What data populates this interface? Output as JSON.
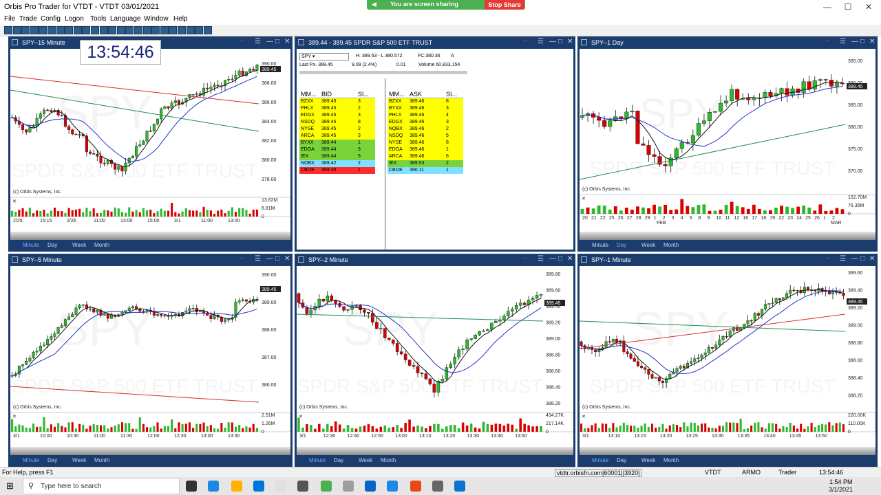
{
  "app": {
    "title": "Orbis Pro Trader for VTDT - VTDT 03/01/2021",
    "sharing_text": "You are screen sharing",
    "stop_share": "Stop Share",
    "clock": "13:54:46"
  },
  "menu": [
    "File",
    "Trade",
    "Config",
    "Logon",
    "Tools",
    "Language",
    "Window",
    "Help"
  ],
  "colors": {
    "panel": "#1b3d6e",
    "up": "#2eb82e",
    "down": "#d80000",
    "yellow": "#ffff00",
    "green": "#7ad33a",
    "cyan": "#7fe0ff",
    "red": "#ff2a2a"
  },
  "panels": {
    "p15": {
      "title": "SPY--15 Minute",
      "yaxis": [
        "390.00",
        "388.00",
        "386.00",
        "384.00",
        "382.00",
        "380.00",
        "378.00"
      ],
      "price": "389.45",
      "xaxis": [
        "2/25",
        "15:15",
        "2/26",
        "11:00",
        "13:00",
        "15:00",
        "3/1",
        "11:00",
        "13:00"
      ],
      "vol": [
        "13.62M",
        "6.81M",
        "0"
      ],
      "tabs": [
        "Minute",
        "Day",
        "Week",
        "Month"
      ]
    },
    "pday": {
      "title": "SPY--1 Day",
      "yaxis": [
        "395.00",
        "390.00",
        "385.00",
        "380.00",
        "375.00",
        "370.00"
      ],
      "price": "389.45",
      "xaxis": [
        "20",
        "21",
        "22",
        "25",
        "26",
        "27",
        "28",
        "29",
        "1",
        "2",
        "3",
        "4",
        "5",
        "8",
        "9",
        "10",
        "11",
        "12",
        "16",
        "17",
        "18",
        "19",
        "22",
        "23",
        "24",
        "25",
        "26",
        "1",
        "2"
      ],
      "month_labels": [
        "FEB",
        "MAR"
      ],
      "vol": [
        "152.70M",
        "76.35M",
        "0"
      ],
      "tabs": [
        "Minute",
        "Day",
        "Week",
        "Month"
      ]
    },
    "p5": {
      "title": "SPY--5 Minute",
      "yaxis": [
        "390.00",
        "389.00",
        "388.00",
        "387.00",
        "386.00"
      ],
      "price": "389.45",
      "xaxis": [
        "3/1",
        "10:00",
        "10:30",
        "11:00",
        "11:30",
        "12:00",
        "12:30",
        "13:00",
        "13:30"
      ],
      "vol": [
        "2.51M",
        "1.26M",
        "0"
      ],
      "tabs": [
        "Minute",
        "Day",
        "Week",
        "Month"
      ]
    },
    "p2": {
      "title": "SPY--2 Minute",
      "yaxis": [
        "389.80",
        "389.60",
        "389.40",
        "389.20",
        "389.00",
        "388.80",
        "388.60",
        "388.40",
        "388.20"
      ],
      "price": "389.45",
      "xaxis": [
        "3/1",
        "12:30",
        "12:40",
        "12:50",
        "13:00",
        "13:10",
        "13:20",
        "13:30",
        "13:40",
        "13:50"
      ],
      "vol": [
        "434.27K",
        "217.14K",
        "0"
      ],
      "tabs": [
        "Minute",
        "Day",
        "Week",
        "Month"
      ]
    },
    "p1": {
      "title": "SPY--1 Minute",
      "yaxis": [
        "389.60",
        "389.40",
        "389.20",
        "389.00",
        "388.80",
        "388.60",
        "388.40",
        "388.20"
      ],
      "price": "389.45",
      "xaxis": [
        "3/1",
        "13:10",
        "13:15",
        "13:20",
        "13:25",
        "13:30",
        "13:35",
        "13:40",
        "13:45",
        "13:50"
      ],
      "vol": [
        "220.00K",
        "110.00K",
        "0"
      ],
      "tabs": [
        "Minute",
        "Day",
        "Week",
        "Month"
      ]
    }
  },
  "copyright": "(c) Orbis Systems, Inc.",
  "watermark": {
    "symbol": "SPY",
    "name": "SPDR S&P 500 ETF TRUST"
  },
  "level2": {
    "title": "389.44 - 389.45   SPDR S&P 500 ETF TRUST",
    "symbol": "SPY",
    "high": "H: 389.63 - L 380.572",
    "fc": "FC:380.36",
    "a": "A",
    "last": "Last Px.  389.45",
    "change": "9.09  (2.4%)",
    "tick": "0.01",
    "volume": "Volume  60,833,154",
    "bid_headers": [
      "MM...",
      "BID",
      "SI..."
    ],
    "ask_headers": [
      "MM...",
      "ASK",
      "SI..."
    ],
    "bids": [
      [
        "BZXX",
        "389.45",
        "3",
        "yellow"
      ],
      [
        "PHLX",
        "389.45",
        "2",
        "yellow"
      ],
      [
        "EDGX",
        "389.45",
        "3",
        "yellow"
      ],
      [
        "NSDQ",
        "389.45",
        "8",
        "yellow"
      ],
      [
        "NYSE",
        "389.45",
        "2",
        "yellow"
      ],
      [
        "ARCA",
        "389.45",
        "3",
        "yellow"
      ],
      [
        "BYXX",
        "389.44",
        "1",
        "green"
      ],
      [
        "EDGA",
        "389.44",
        "3",
        "green"
      ],
      [
        "IEX",
        "389.44",
        "5",
        "green"
      ],
      [
        "NOBX",
        "389.42",
        "2",
        "cyan"
      ],
      [
        "CBOE",
        "389.39",
        "1",
        "red"
      ]
    ],
    "asks": [
      [
        "BZXX",
        "389.46",
        "8",
        "yellow"
      ],
      [
        "BYXX",
        "389.46",
        "3",
        "yellow"
      ],
      [
        "PHLX",
        "389.46",
        "4",
        "yellow"
      ],
      [
        "EDGX",
        "389.46",
        "3",
        "yellow"
      ],
      [
        "NQBX",
        "389.46",
        "2",
        "yellow"
      ],
      [
        "NSDQ",
        "389.46",
        "5",
        "yellow"
      ],
      [
        "NYSE",
        "389.46",
        "8",
        "yellow"
      ],
      [
        "EDGA",
        "389.46",
        "1",
        "yellow"
      ],
      [
        "ARCA",
        "389.46",
        "6",
        "yellow"
      ],
      [
        "IEX",
        "389.53",
        "2",
        "green"
      ],
      [
        "CBOE",
        "390.11",
        "1",
        "cyan"
      ]
    ]
  },
  "status": {
    "help": "For Help, press F1",
    "server": "vtdtr.orbisfn.com|60001||3920|",
    "acct": "VTDT",
    "user": "ARMO",
    "role": "Trader",
    "time": "13:54:46"
  },
  "taskbar": {
    "search_placeholder": "Type here to search",
    "time": "1:54 PM",
    "date": "3/1/2021"
  }
}
